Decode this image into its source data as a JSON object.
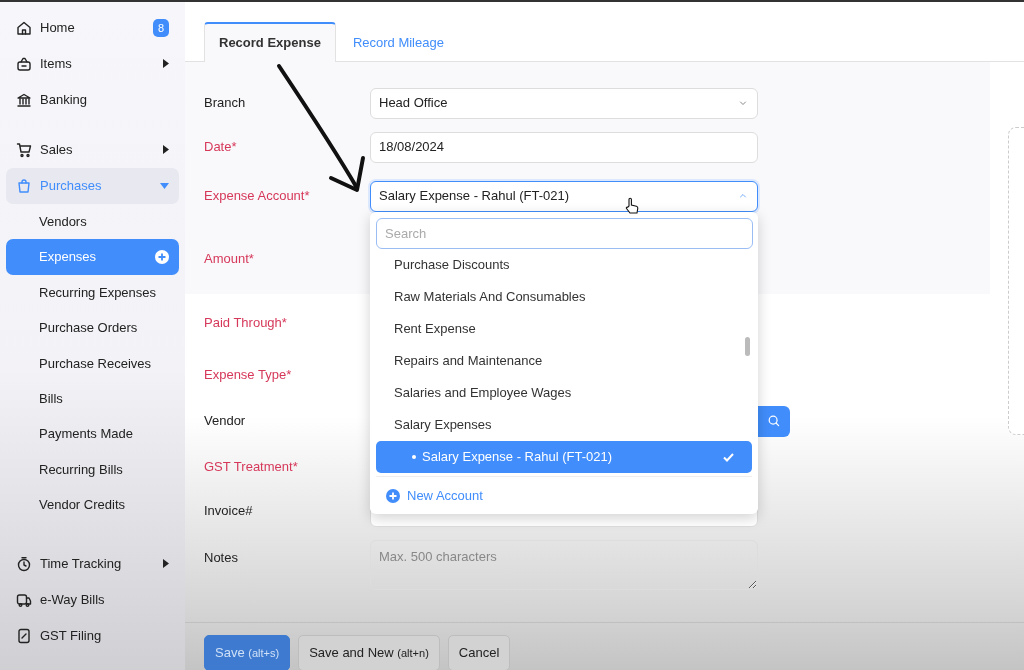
{
  "sidebar": {
    "sections": [
      {
        "items": [
          {
            "label": "Home",
            "badge": "8",
            "selected": false
          },
          {
            "label": "Items",
            "expanded": false,
            "selected": false
          },
          {
            "label": "Banking",
            "selected": false
          }
        ]
      },
      {
        "items": [
          {
            "label": "Sales",
            "expanded": false,
            "selected": false
          },
          {
            "label": "Purchases",
            "expanded": true,
            "selected": true,
            "children": [
              {
                "label": "Vendors",
                "selected": false
              },
              {
                "label": "Expenses",
                "selected": true
              },
              {
                "label": "Recurring Expenses",
                "selected": false
              },
              {
                "label": "Purchase Orders",
                "selected": false
              },
              {
                "label": "Purchase Receives",
                "selected": false
              },
              {
                "label": "Bills",
                "selected": false
              },
              {
                "label": "Payments Made",
                "selected": false
              },
              {
                "label": "Recurring Bills",
                "selected": false
              },
              {
                "label": "Vendor Credits",
                "selected": false
              }
            ]
          }
        ]
      },
      {
        "items": [
          {
            "label": "Time Tracking",
            "expanded": false,
            "selected": false
          },
          {
            "label": "e-Way Bills",
            "selected": false
          },
          {
            "label": "GST Filing",
            "selected": false
          }
        ]
      }
    ]
  },
  "tabs": [
    {
      "label": "Record Expense",
      "selected": true
    },
    {
      "label": "Record Mileage",
      "selected": false
    }
  ],
  "form": {
    "fields": [
      {
        "label": "Branch",
        "required": false,
        "kind": "select",
        "value": "Head Office"
      },
      {
        "label": "Date*",
        "required": true,
        "kind": "input",
        "value": "18/08/2024"
      },
      {
        "label": "Expense Account*",
        "required": true,
        "kind": "select",
        "value": "Salary Expense - Rahul (FT-021)",
        "expanded": true
      },
      {
        "label": "Amount*",
        "required": true,
        "kind": "covered"
      },
      {
        "label": "Paid Through*",
        "required": true,
        "kind": "covered"
      },
      {
        "label": "Expense Type*",
        "required": true,
        "kind": "covered"
      },
      {
        "label": "Vendor",
        "required": false,
        "kind": "search"
      },
      {
        "label": "GST Treatment*",
        "required": true,
        "kind": "covered"
      },
      {
        "label": "Invoice#",
        "required": false,
        "kind": "input"
      },
      {
        "label": "Notes",
        "required": false,
        "kind": "textarea",
        "placeholder": "Max. 500 characters"
      }
    ]
  },
  "dropdown": {
    "search": {
      "placeholder": "Search"
    },
    "options": [
      {
        "label": "Purchase Discounts",
        "selected": false
      },
      {
        "label": "Raw Materials And Consumables",
        "selected": false
      },
      {
        "label": "Rent Expense",
        "selected": false
      },
      {
        "label": "Repairs and Maintenance",
        "selected": false
      },
      {
        "label": "Salaries and Employee Wages",
        "selected": false
      },
      {
        "label": "Salary Expenses",
        "selected": false,
        "children": [
          {
            "label": "Salary Expense - Rahul (FT-021)",
            "selected": true
          }
        ]
      }
    ],
    "action": "New Account"
  },
  "buttons": [
    {
      "label": "Save",
      "shortcut": "(alt+s)",
      "kind": "primary"
    },
    {
      "label": "Save and New",
      "shortcut": "(alt+n)",
      "kind": "default"
    },
    {
      "label": "Cancel",
      "kind": "default"
    }
  ]
}
